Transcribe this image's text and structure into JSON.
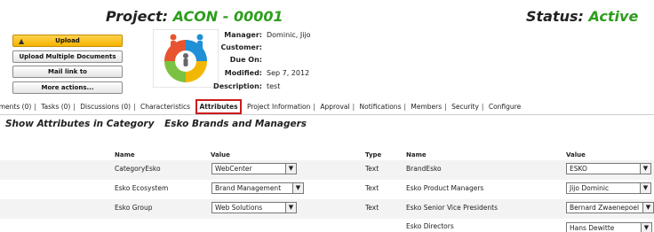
{
  "header": {
    "project_label": "Project:",
    "project_code": "ACON - 00001",
    "status_label": "Status:",
    "status_value": "Active"
  },
  "actions": {
    "upload": "Upload",
    "upload_multiple": "Upload Multiple Documents",
    "mail_link": "Mail link to",
    "more_actions": "More actions..."
  },
  "meta": [
    {
      "label": "Manager:",
      "value": "Dominic, Jijo"
    },
    {
      "label": "Customer:",
      "value": ""
    },
    {
      "label": "Due On:",
      "value": ""
    },
    {
      "label": "Modified:",
      "value": "Sep 7, 2012"
    },
    {
      "label": "Description:",
      "value": "test"
    }
  ],
  "tabs": [
    "uments (0)",
    "Tasks (0)",
    "Discussions (0)",
    "Characteristics",
    "Attributes",
    "Project Information",
    "Approval",
    "Notifications",
    "Members",
    "Security",
    "Configure"
  ],
  "section": {
    "title": "Show Attributes in Category",
    "category": "Esko Brands and Managers"
  },
  "table": {
    "headers": {
      "name": "Name",
      "value": "Value",
      "type": "Type",
      "name2": "Name",
      "value2": "Value"
    },
    "rows": [
      {
        "name": "CategoryEsko",
        "value": "WebCenter",
        "type": "Text",
        "name2": "BrandEsko",
        "value2": "ESKO"
      },
      {
        "name": "Esko Ecosystem",
        "value": "Brand Management",
        "type": "Text",
        "name2": "Esko Product Managers",
        "value2": "Jijo Dominic"
      },
      {
        "name": "Esko Group",
        "value": "Web Solutions",
        "type": "Text",
        "name2": "Esko Senior Vice Presidents",
        "value2": "Bernard Zwaenepoel"
      },
      {
        "name": "",
        "value": "",
        "type": "",
        "name2": "Esko Directors",
        "value2": "Hans Dewitte"
      }
    ]
  },
  "colors": {
    "accent_green": "#2e9d1e",
    "active_tab_border": "#cc1b1b",
    "primary_button": "#f5b400"
  }
}
